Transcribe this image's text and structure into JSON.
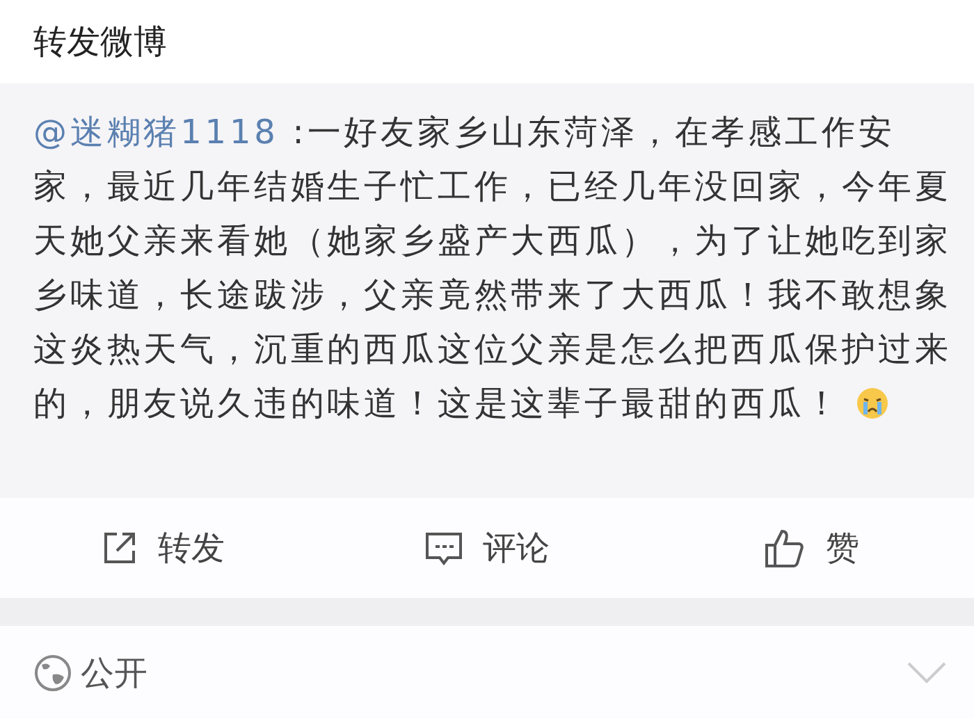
{
  "header": {
    "title": "转发微博"
  },
  "post": {
    "mention": "@迷糊猪1118",
    "text": " :一好友家乡山东菏泽，在孝感工作安家，最近几年结婚生子忙工作，已经几年没回家，今年夏天她父亲来看她（她家乡盛产大西瓜），为了让她吃到家乡味道，长途跋涉，父亲竟然带来了大西瓜！我不敢想象这炎热天气，沉重的西瓜这位父亲是怎么把西瓜保护过来的，朋友说久违的味道！这是这辈子最甜的西瓜！"
  },
  "actions": [
    {
      "kind": "repost",
      "label": "转发"
    },
    {
      "kind": "comment",
      "label": "评论"
    },
    {
      "kind": "like",
      "label": "赞"
    }
  ],
  "privacy": {
    "label": "公开"
  }
}
